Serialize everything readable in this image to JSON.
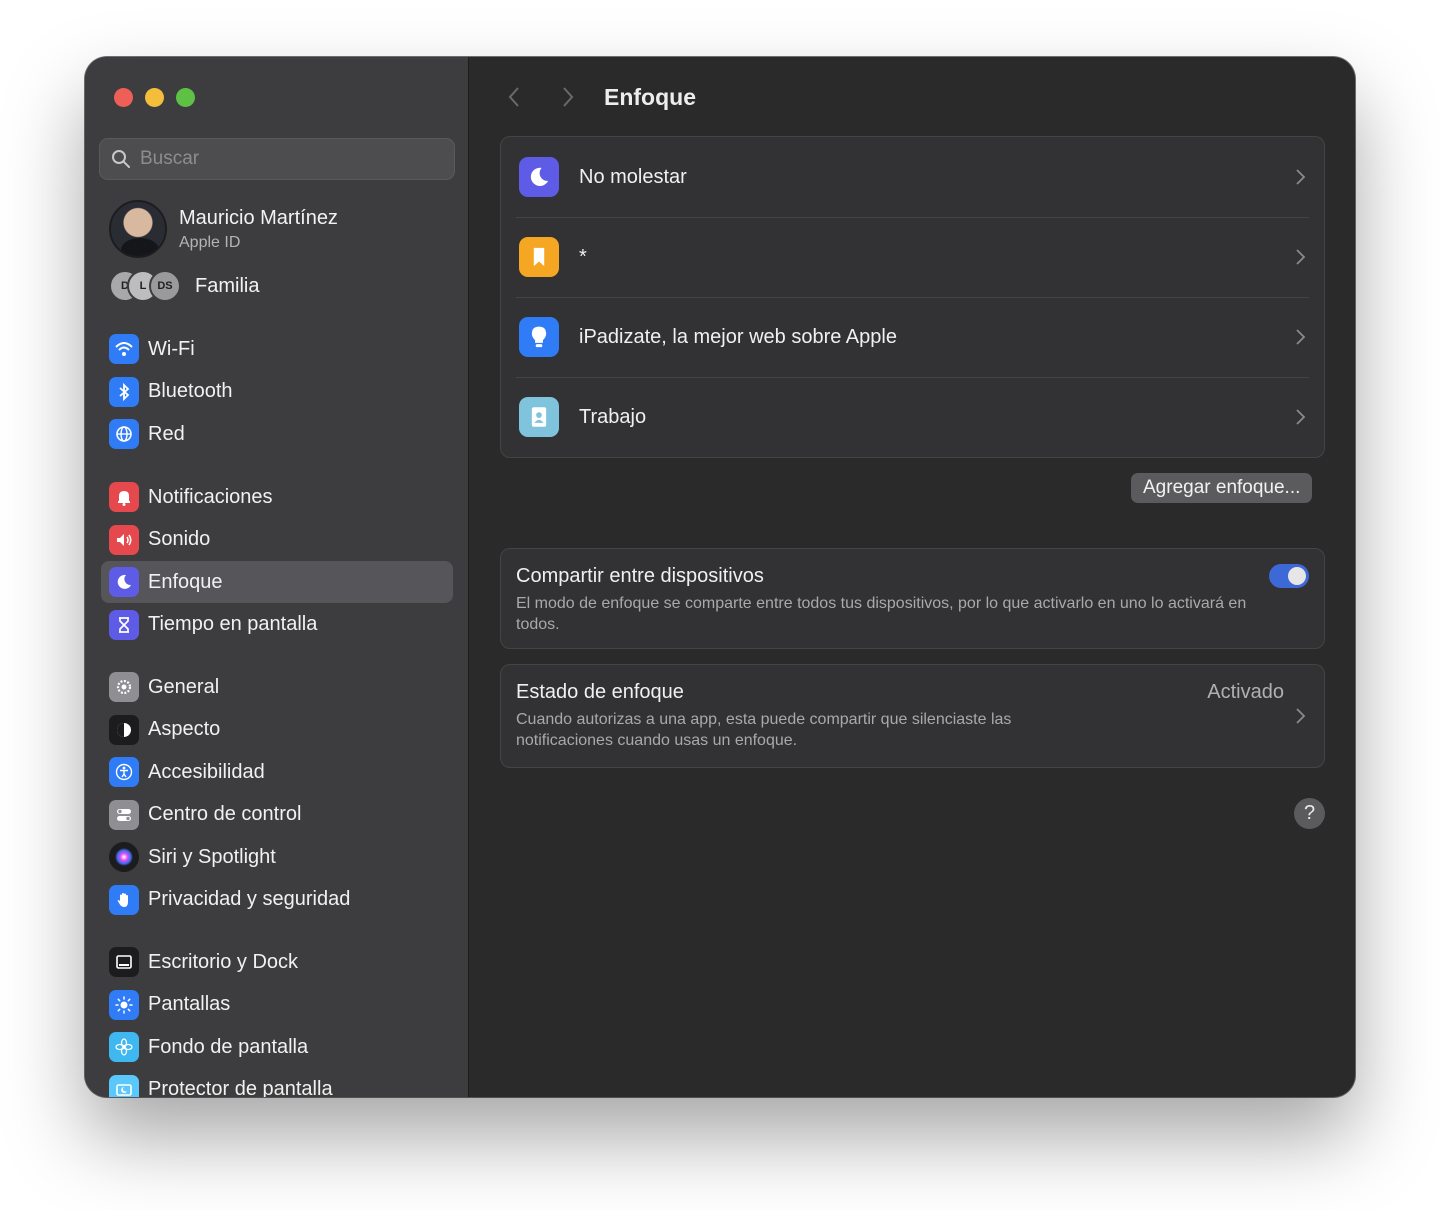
{
  "search": {
    "placeholder": "Buscar"
  },
  "profile": {
    "name": "Mauricio Martínez",
    "subtitle": "Apple ID"
  },
  "family": {
    "label": "Familia",
    "avatars": [
      "D",
      "L",
      "DS"
    ]
  },
  "sidebar": {
    "groups": [
      [
        {
          "label": "Wi-Fi",
          "icon": "wifi-icon",
          "color": "#2f7cf6"
        },
        {
          "label": "Bluetooth",
          "icon": "bluetooth-icon",
          "color": "#2f7cf6"
        },
        {
          "label": "Red",
          "icon": "globe-icon",
          "color": "#2f7cf6"
        }
      ],
      [
        {
          "label": "Notificaciones",
          "icon": "bell-icon",
          "color": "#e5484d"
        },
        {
          "label": "Sonido",
          "icon": "speaker-icon",
          "color": "#e5484d"
        },
        {
          "label": "Enfoque",
          "icon": "moon-icon",
          "color": "#5e5ce6",
          "active": true
        },
        {
          "label": "Tiempo en pantalla",
          "icon": "hourglass-icon",
          "color": "#5e5ce6"
        }
      ],
      [
        {
          "label": "General",
          "icon": "gear-icon",
          "color": "#8e8e93"
        },
        {
          "label": "Aspecto",
          "icon": "appearance-icon",
          "color": "#1c1c1e"
        },
        {
          "label": "Accesibilidad",
          "icon": "accessibility-icon",
          "color": "#2f7cf6"
        },
        {
          "label": "Centro de control",
          "icon": "toggles-icon",
          "color": "#8e8e93"
        },
        {
          "label": "Siri y Spotlight",
          "icon": "siri-icon",
          "color": "#1c1c1e"
        },
        {
          "label": "Privacidad y seguridad",
          "icon": "hand-icon",
          "color": "#2f7cf6"
        }
      ],
      [
        {
          "label": "Escritorio y Dock",
          "icon": "dock-icon",
          "color": "#1c1c1e"
        },
        {
          "label": "Pantallas",
          "icon": "sun-icon",
          "color": "#2f7cf6"
        },
        {
          "label": "Fondo de pantalla",
          "icon": "flower-icon",
          "color": "#3fb7f0"
        },
        {
          "label": "Protector de pantalla",
          "icon": "screensaver-icon",
          "color": "#5ac8fa"
        }
      ]
    ]
  },
  "main": {
    "title": "Enfoque",
    "focus_modes": [
      {
        "label": "No molestar",
        "icon": "moon-icon",
        "color": "#5e5ce6"
      },
      {
        "label": "*",
        "icon": "bookmark-icon",
        "color": "#f5a623"
      },
      {
        "label": "iPadizate, la mejor web sobre Apple",
        "icon": "lightbulb-icon",
        "color": "#2f7cf6"
      },
      {
        "label": "Trabajo",
        "icon": "badge-icon",
        "color": "#7fc4dc"
      }
    ],
    "add_button": "Agregar enfoque...",
    "share": {
      "title": "Compartir entre dispositivos",
      "description": "El modo de enfoque se comparte entre todos tus dispositivos, por lo que activarlo en uno lo activará en todos.",
      "enabled": true
    },
    "estado": {
      "title": "Estado de enfoque",
      "value": "Activado",
      "description": "Cuando autorizas a una app, esta puede compartir que silenciaste las notificaciones cuando usas un enfoque."
    },
    "help": "?"
  }
}
